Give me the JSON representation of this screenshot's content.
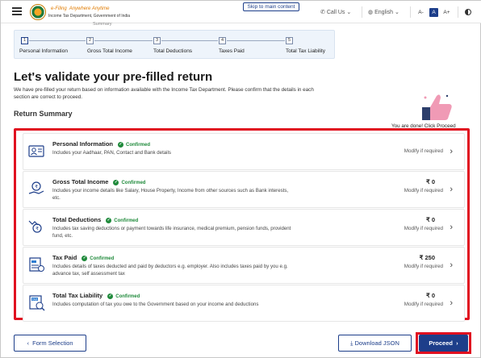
{
  "header": {
    "logo_title": "e-Filing",
    "logo_tagline": "Anywhere Anytime",
    "logo_subtitle": "Income Tax Department, Government of India",
    "skip_link": "Skip to main content",
    "call_us": "Call Us",
    "language": "English",
    "font_decrease": "A-",
    "font_normal": "A",
    "font_increase": "A+",
    "icons": [
      "menu-icon",
      "phone-icon",
      "globe-icon",
      "contrast-icon"
    ]
  },
  "stepper": {
    "summary_label": "Summary",
    "steps": [
      {
        "num": "1",
        "label": "Personal Information"
      },
      {
        "num": "2",
        "label": "Gross Total Income"
      },
      {
        "num": "3",
        "label": "Total Deductions"
      },
      {
        "num": "4",
        "label": "Taxes Paid"
      },
      {
        "num": "5",
        "label": "Total Tax Liability"
      }
    ]
  },
  "main": {
    "title": "Let's validate your pre-filled return",
    "description": "We have pre-filled your return based on information available with the Income Tax Department. Please confirm that the details in each section are correct to proceed.",
    "section_title": "Return Summary",
    "done_text": "You are done! Click Proceed"
  },
  "rows": [
    {
      "title": "Personal Information",
      "status": "Confirmed",
      "desc": "Includes your Aadhaar, PAN, Contact and Bank details",
      "amount": "",
      "action": "Modify if required",
      "icon": "person-card-icon"
    },
    {
      "title": "Gross Total Income",
      "status": "Confirmed",
      "desc": "Includes your income details like Salary, House Property, Income from other sources such as Bank interests, etc.",
      "amount": "₹ 0",
      "action": "Modify if required",
      "icon": "income-hand-icon"
    },
    {
      "title": "Total Deductions",
      "status": "Confirmed",
      "desc": "Includes tax saving deductions or payment towards life insurance, medical premium, pension funds, provident fund, etc.",
      "amount": "₹ 0",
      "action": "Modify if required",
      "icon": "deduction-icon"
    },
    {
      "title": "Tax Paid",
      "status": "Confirmed",
      "desc": "Includes details of taxes deducted and paid by deductors e.g. employer. Also includes taxes paid by you e.g. advance tax, self assessment tax",
      "amount": "₹ 250",
      "action": "Modify if required",
      "icon": "tax-doc-icon"
    },
    {
      "title": "Total Tax Liability",
      "status": "Confirmed",
      "desc": "Includes computation of tax you owe to the Government based on your income and deductions",
      "amount": "₹ 0",
      "action": "Modify if required",
      "icon": "tax-calc-icon"
    }
  ],
  "footer": {
    "back_label": "Form Selection",
    "download_label": "Download JSON",
    "proceed_label": "Proceed"
  },
  "colors": {
    "brand": "#1d3e8a",
    "highlight": "#e01020",
    "confirmed": "#1f8a3b"
  }
}
